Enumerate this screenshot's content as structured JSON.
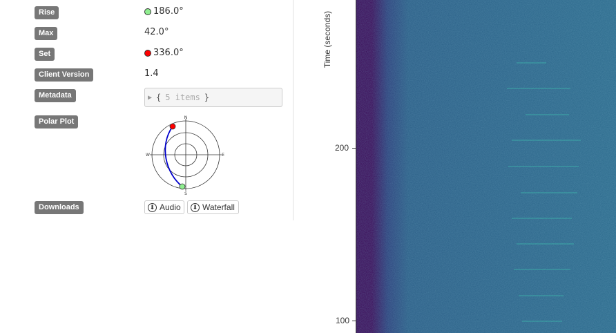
{
  "fields": {
    "rise": {
      "label": "Rise",
      "value": "186.0°",
      "dot_color": "#90ee90"
    },
    "max": {
      "label": "Max",
      "value": "42.0°"
    },
    "set": {
      "label": "Set",
      "value": "336.0°",
      "dot_color": "#ff0000"
    },
    "client_version": {
      "label": "Client Version",
      "value": "1.4"
    },
    "metadata": {
      "label": "Metadata",
      "open_brace": "{",
      "items": "5 items",
      "close_brace": "}"
    },
    "polar_plot": {
      "label": "Polar Plot",
      "compass": {
        "north": "N",
        "south": "S",
        "east": "E",
        "west": "W"
      }
    },
    "downloads": {
      "label": "Downloads",
      "audio": "Audio",
      "waterfall": "Waterfall"
    }
  },
  "waterfall": {
    "axis_label": "Time (seconds)",
    "ticks": [
      "200",
      "100"
    ],
    "colors": {
      "background": "#2c6488",
      "edge": "#3b0a57",
      "line": "#3fc0b0"
    }
  }
}
